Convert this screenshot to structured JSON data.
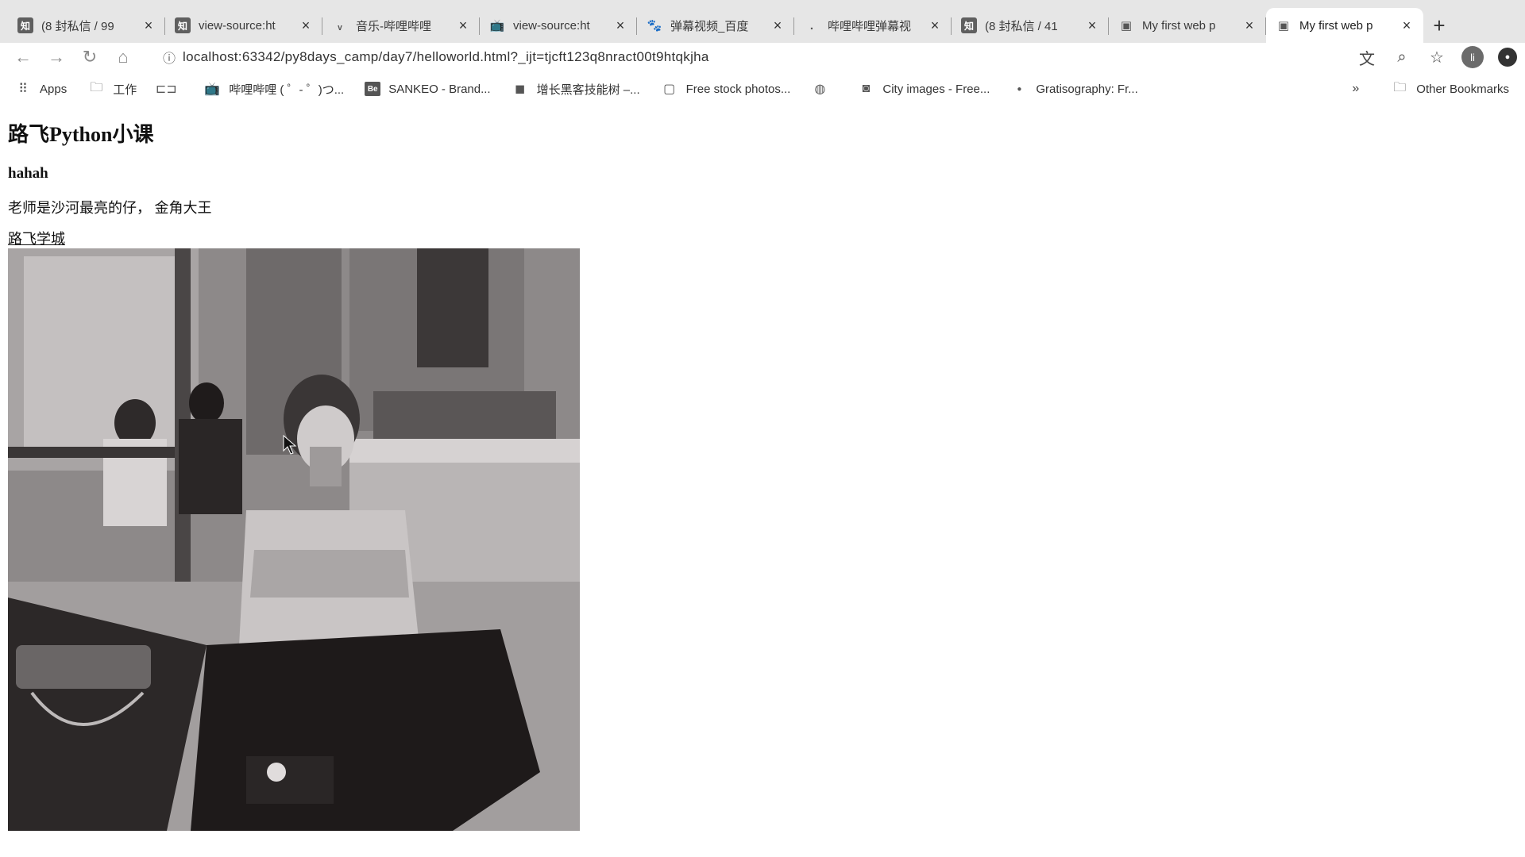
{
  "tabs": [
    {
      "favicon": "知",
      "title": "(8 封私信 / 99",
      "active": false
    },
    {
      "favicon": "知",
      "title": "view-source:ht",
      "active": false
    },
    {
      "favicon": "",
      "title": "音乐-哔哩哔哩",
      "active": false
    },
    {
      "favicon": "tv-icon",
      "title": "view-source:ht",
      "active": false
    },
    {
      "favicon": "paw-icon",
      "title": "弹幕视频_百度",
      "active": false
    },
    {
      "favicon": "",
      "title": "哔哩哔哩弹幕视",
      "active": false
    },
    {
      "favicon": "知",
      "title": "(8 封私信 / 41",
      "active": false
    },
    {
      "favicon": "page-icon",
      "title": "My first web p",
      "active": false
    },
    {
      "favicon": "page-icon",
      "title": "My first web p",
      "active": true
    }
  ],
  "toolbar": {
    "url": "localhost:63342/py8days_camp/day7/helloworld.html?_ijt=tjcft123q8nract00t9htqkjha"
  },
  "profile": {
    "initial": "li"
  },
  "bookmarks": {
    "items": [
      {
        "icon": "apps-grid-icon",
        "label": "Apps"
      },
      {
        "icon": "folder-icon",
        "label": "工作"
      },
      {
        "icon": "bracket-icon",
        "label": ""
      },
      {
        "icon": "tv-icon",
        "label": "哔哩哔哩 ( ゜- ゜)つ..."
      },
      {
        "icon": "Be",
        "label": "SANKEO - Brand..."
      },
      {
        "icon": "cube-icon",
        "label": "增长黑客技能树 –..."
      },
      {
        "icon": "photo-icon",
        "label": "Free stock photos..."
      },
      {
        "icon": "globe-icon",
        "label": ""
      },
      {
        "icon": "camera-icon",
        "label": "City images - Free..."
      },
      {
        "icon": "dot-icon",
        "label": "Gratisography: Fr..."
      }
    ],
    "overflow": "»",
    "other": "Other Bookmarks"
  },
  "page": {
    "h1": "路飞Python小课",
    "h3": "hahah",
    "paragraph": "老师是沙河最亮的仔， 金角大王",
    "link": "路飞学城"
  }
}
